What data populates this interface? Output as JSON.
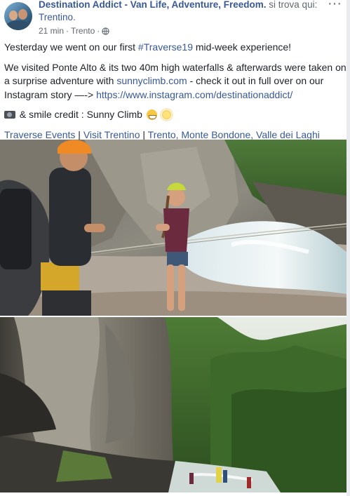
{
  "post": {
    "author": "Destination Addict - Van Life, Adventure, Freedom.",
    "checkin_text": " si trova qui: ",
    "place": "Trentino",
    "place_suffix": ".",
    "time": "21 min",
    "dot": "·",
    "location": "Trento",
    "dot2": "·",
    "more": "···"
  },
  "body": {
    "p1_prefix": "Yesterday we went on our first ",
    "hashtag": "#Traverse19",
    "p1_suffix": " mid-week experience!",
    "p2_prefix": "We visited Ponte Alto & its two 40m high waterfalls & afterwards were taken on a surprise adventure with ",
    "p2_link": "sunnyclimb.com",
    "p2_mid": " - check it out in full over on our Instagram story —-> ",
    "p2_url": "https://www.instagram.com/destinationaddict/",
    "p3_text": " & smile credit : Sunny Climb ",
    "tags": [
      "Traverse Events",
      "Visit Trentino",
      "Trento, Monte Bondone, Valle dei Laghi"
    ],
    "tag_sep": " | "
  },
  "icons": {
    "globe": "globe-icon",
    "camera": "camera-emoji",
    "grin": "grinning-face-emoji",
    "sun": "sun-emoji"
  },
  "colors": {
    "link": "#385898",
    "text": "#1d2129",
    "meta": "#616770"
  }
}
